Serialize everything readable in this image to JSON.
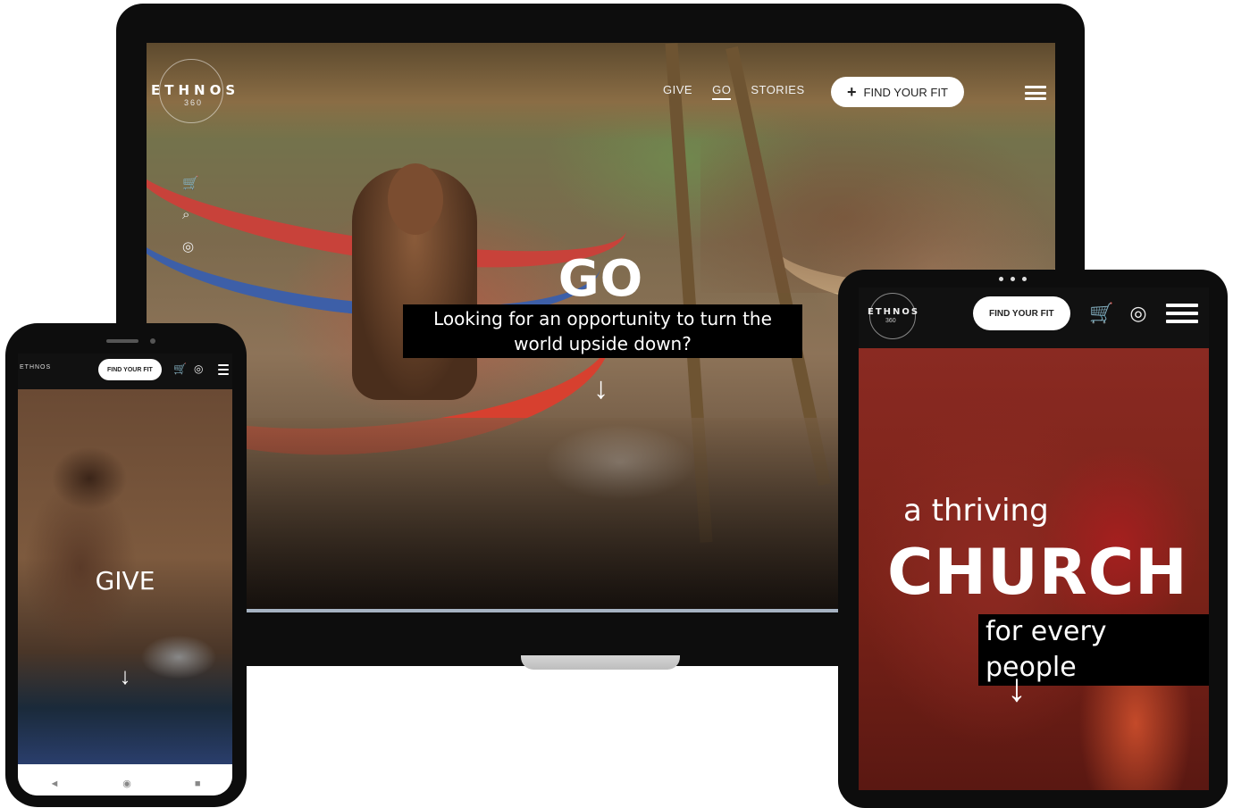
{
  "brand": {
    "name": "ETHNOS",
    "sub": "360"
  },
  "desktop": {
    "nav": [
      "GIVE",
      "GO",
      "STORIES"
    ],
    "active_nav": "GO",
    "cta_label": "FIND YOUR FIT",
    "cta_icon": "+",
    "hero_title": "GO",
    "hero_subtitle": "Looking for an opportunity to turn the world upside down?",
    "scroll_arrow": "↓",
    "cart_count": "0"
  },
  "phone": {
    "cta_label": "FIND YOUR FIT",
    "hero_title": "GIVE",
    "scroll_arrow": "↓",
    "nav_back": "◄",
    "nav_home": "◉",
    "nav_recent": "■"
  },
  "tablet": {
    "cta_label": "FIND YOUR FIT",
    "cart_count": "0",
    "hero_small": "a thriving",
    "hero_big": "CHURCH",
    "hero_tag": "for every people",
    "scroll_arrow": "↓"
  },
  "icons": {
    "cart": "🛒",
    "search": "⌕",
    "user": "◎"
  },
  "colors": {
    "cta_bg": "#ffffff",
    "caption_bg": "#000000",
    "device_frame": "#0d0d0d"
  }
}
